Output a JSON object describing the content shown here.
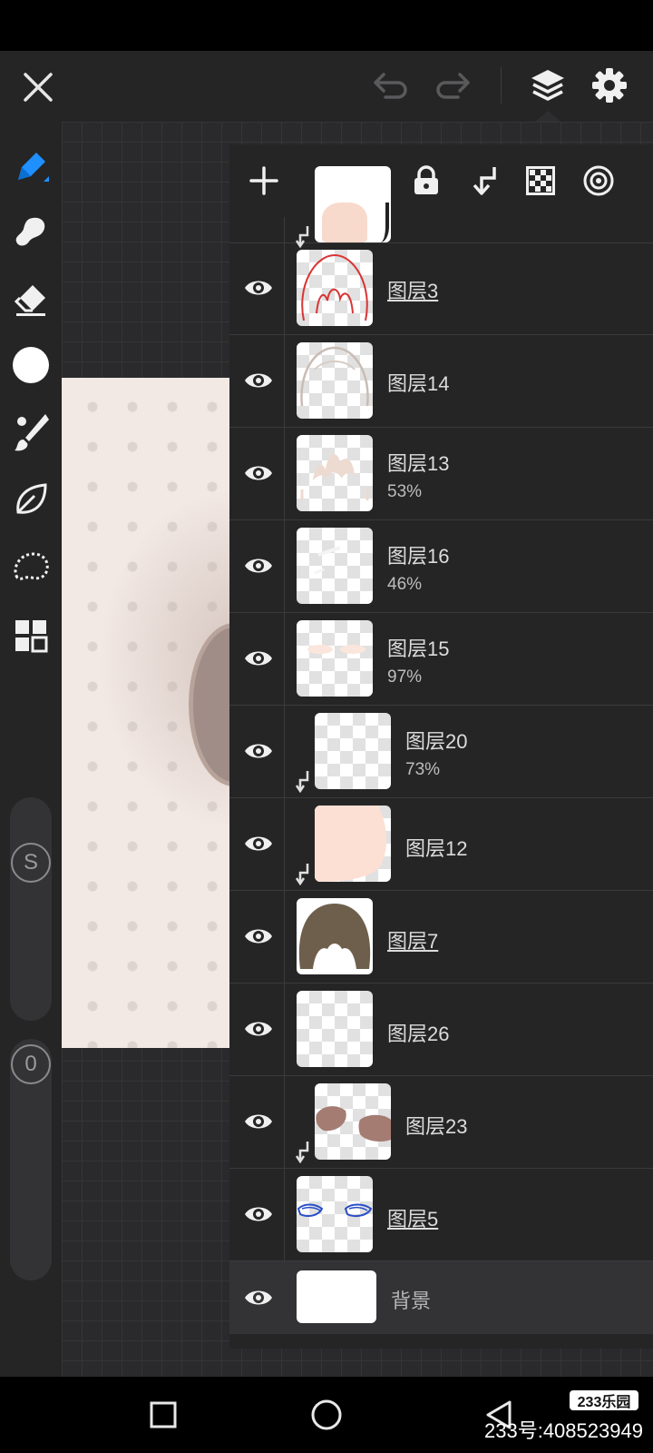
{
  "layers_panel": {
    "layers": [
      {
        "name": "图层3",
        "opacity": "",
        "underlined": true
      },
      {
        "name": "图层14",
        "opacity": "",
        "underlined": false
      },
      {
        "name": "图层13",
        "opacity": "53%",
        "underlined": false
      },
      {
        "name": "图层16",
        "opacity": "46%",
        "underlined": false
      },
      {
        "name": "图层15",
        "opacity": "97%",
        "underlined": false
      },
      {
        "name": "图层20",
        "opacity": "73%",
        "underlined": false
      },
      {
        "name": "图层12",
        "opacity": "",
        "underlined": false
      },
      {
        "name": "图层7",
        "opacity": "",
        "underlined": true
      },
      {
        "name": "图层26",
        "opacity": "",
        "underlined": false
      },
      {
        "name": "图层23",
        "opacity": "",
        "underlined": false
      },
      {
        "name": "图层5",
        "opacity": "",
        "underlined": true
      }
    ],
    "background_layer": "背景"
  },
  "toolbar": {
    "stabilizer_label": "S",
    "value_label": "0"
  },
  "watermark": {
    "badge": "233乐园",
    "text": "233号:408523949"
  },
  "colors": {
    "accent": "#1e90ff",
    "panel_bg": "#252526",
    "current_color": "#ffffff"
  }
}
